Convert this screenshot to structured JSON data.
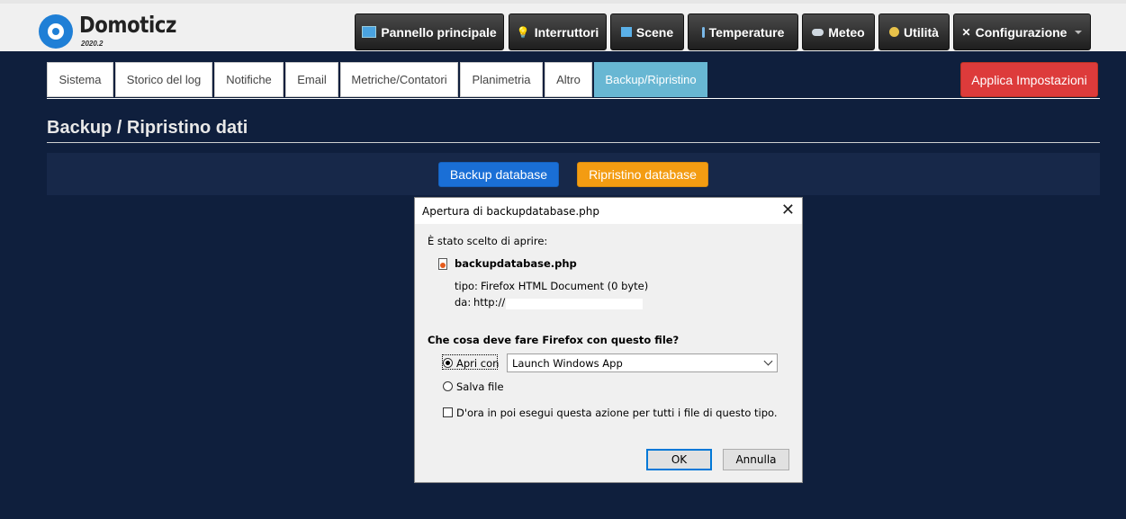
{
  "app": {
    "name": "Domoticz",
    "version": "2020.2"
  },
  "nav": [
    {
      "label": "Pannello principale",
      "icon": "dashboard-icon"
    },
    {
      "label": "Interruttori",
      "icon": "lightbulb-icon"
    },
    {
      "label": "Scene",
      "icon": "clapperboard-icon"
    },
    {
      "label": "Temperature",
      "icon": "thermometer-icon"
    },
    {
      "label": "Meteo",
      "icon": "cloud-icon"
    },
    {
      "label": "Utilità",
      "icon": "utility-icon"
    },
    {
      "label": "Configurazione",
      "icon": "tools-icon"
    }
  ],
  "tabs": [
    "Sistema",
    "Storico del log",
    "Notifiche",
    "Email",
    "Metriche/Contatori",
    "Planimetria",
    "Altro",
    "Backup/Ripristino"
  ],
  "active_tab": "Backup/Ripristino",
  "apply_label": "Applica Impostazioni",
  "section_title": "Backup / Ripristino dati",
  "backup_label": "Backup database",
  "restore_label": "Ripristino database",
  "dialog": {
    "title": "Apertura di backupdatabase.php",
    "chosen_text": "È stato scelto di aprire:",
    "filename": "backupdatabase.php",
    "type_label": "tipo:",
    "type_value": "Firefox HTML Document (0 byte)",
    "from_label": "da:",
    "from_value": "http://",
    "question": "Che cosa deve fare Firefox con questo file?",
    "open_with_label": "Apri con",
    "open_with_app": "Launch Windows App",
    "save_label": "Salva file",
    "remember_label": "D'ora in poi esegui questa azione per tutti i file di questo tipo.",
    "ok_label": "OK",
    "cancel_label": "Annulla"
  },
  "colors": {
    "background": "#0f1f3d",
    "active_tab": "#68b7d3",
    "apply": "#dd3b3b",
    "backup": "#1a6fd6",
    "restore": "#f39c12"
  }
}
